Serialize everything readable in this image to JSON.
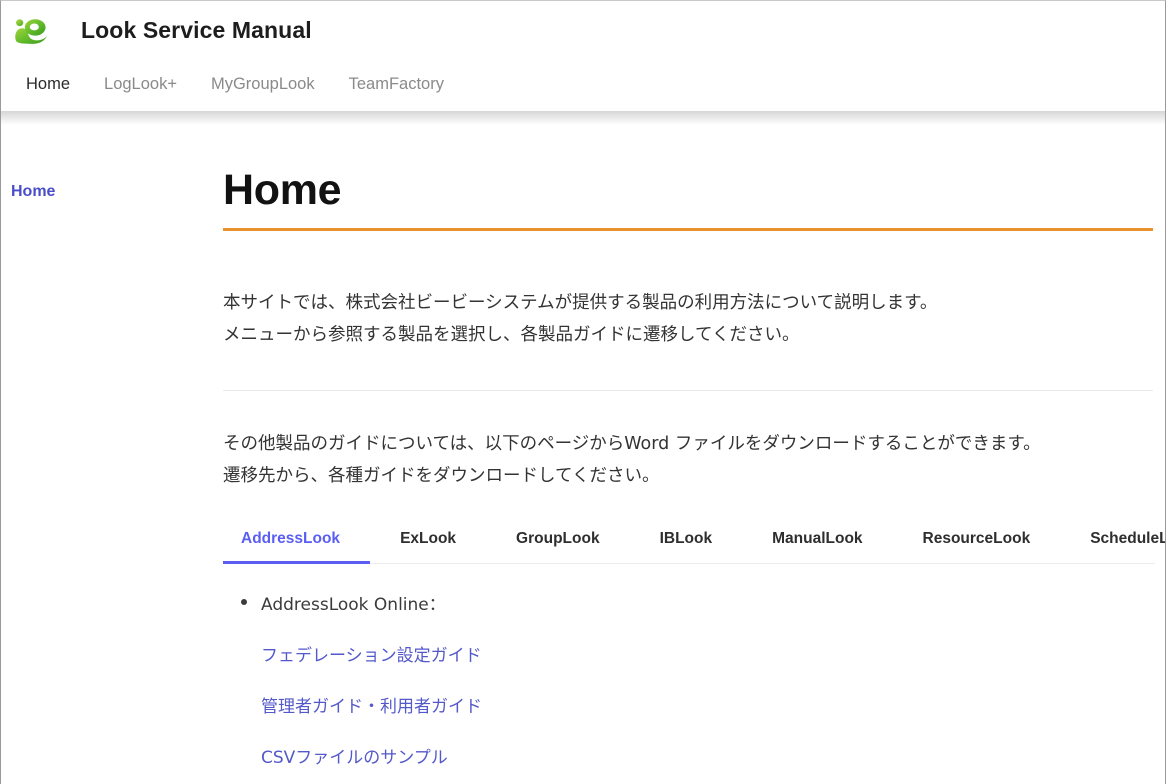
{
  "site": {
    "logo_icon": "green-blob-logo-icon",
    "title": "Look Service Manual",
    "accent_orange": "#e8912d",
    "accent_indigo": "#5b5ef4",
    "link_color": "#5359c9"
  },
  "header_nav": {
    "items": [
      {
        "label": "Home",
        "active": true
      },
      {
        "label": "LogLook+",
        "active": false
      },
      {
        "label": "MyGroupLook",
        "active": false
      },
      {
        "label": "TeamFactory",
        "active": false
      }
    ]
  },
  "sidebar": {
    "items": [
      {
        "label": "Home",
        "active": true
      }
    ]
  },
  "main": {
    "page_title": "Home",
    "paragraph_1": {
      "line_1": "本サイトでは、株式会社ビービーシステムが提供する製品の利用方法について説明します。",
      "line_2": "メニューから参照する製品を選択し、各製品ガイドに遷移してください。"
    },
    "paragraph_2": {
      "line_1": "その他製品のガイドについては、以下のページからWord ファイルをダウンロードすることができます。",
      "line_2": "遷移先から、各種ガイドをダウンロードしてください。"
    },
    "tabs": [
      {
        "label": "AddressLook",
        "active": true
      },
      {
        "label": "ExLook",
        "active": false
      },
      {
        "label": "GroupLook",
        "active": false
      },
      {
        "label": "IBLook",
        "active": false
      },
      {
        "label": "ManualLook",
        "active": false
      },
      {
        "label": "ResourceLook",
        "active": false
      },
      {
        "label": "ScheduleLook",
        "active": false
      }
    ],
    "tab_panel": {
      "heading": "AddressLook Online：",
      "links": [
        {
          "label": "フェデレーション設定ガイド"
        },
        {
          "label": "管理者ガイド・利用者ガイド"
        },
        {
          "label": "CSVファイルのサンプル"
        }
      ]
    }
  }
}
